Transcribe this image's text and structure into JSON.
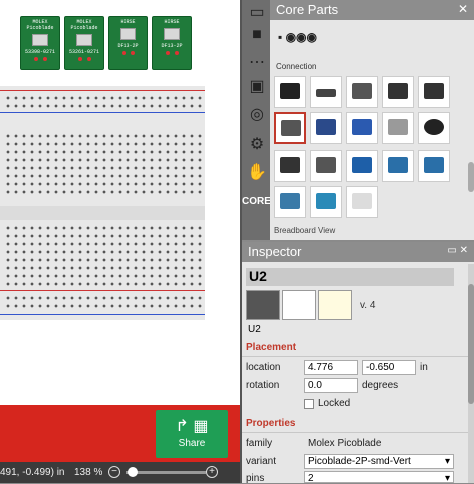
{
  "parts_bin": {
    "title": "Core Parts",
    "close_icon": "close-icon",
    "logo": "fritzing-logo",
    "section_connection": "Connection",
    "section_breadboard_view": "Breadboard View",
    "core_label": "CORE"
  },
  "canvas_parts": [
    {
      "brand": "MOLEX",
      "name": "Picoblade",
      "pn": "53398-0271"
    },
    {
      "brand": "MOLEX",
      "name": "Picoblade",
      "pn": "53261-0271"
    },
    {
      "brand": "HIRSE",
      "name": "",
      "pn": "DF13-2P"
    },
    {
      "brand": "HIRSE",
      "name": "",
      "pn": "DF13-2P"
    }
  ],
  "inspector": {
    "title": "Inspector",
    "part_name": "U2",
    "version": "v. 4",
    "part_label": "U2",
    "placement_header": "Placement",
    "location_label": "location",
    "location_x": "4.776",
    "location_y": "-0.650",
    "location_unit": "in",
    "rotation_label": "rotation",
    "rotation_value": "0.0",
    "rotation_unit": "degrees",
    "locked_label": "Locked",
    "properties_header": "Properties",
    "family_label": "family",
    "family_value": "Molex Picoblade",
    "variant_label": "variant",
    "variant_value": "Picoblade-2P-smd-Vert",
    "pins_label": "pins",
    "pins_value": "2"
  },
  "status": {
    "coords": "491, -0.499) in",
    "zoom": "138 %",
    "zoom_out": "−",
    "zoom_in": "+"
  },
  "share": {
    "label": "Share"
  }
}
